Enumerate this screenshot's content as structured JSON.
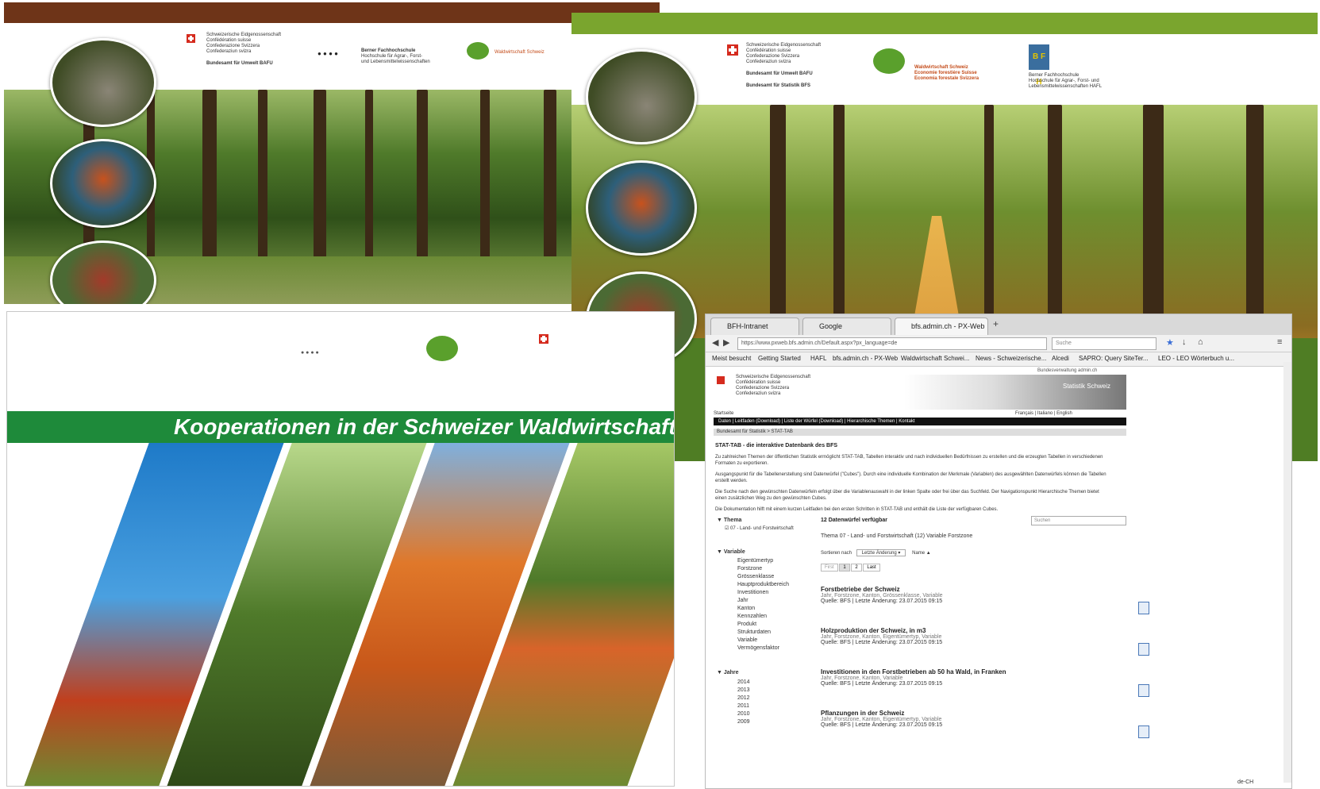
{
  "panel1": {
    "header_lines": [
      "Schweizerische Eidgenossenschaft",
      "Confédération suisse",
      "Confederazione Svizzera",
      "Confederaziun svizra"
    ],
    "office": "Bundesamt für Umwelt BAFU",
    "school": "Berner Fachhochschule",
    "school_sub": [
      "Hochschule für Agrar-, Forst-",
      "und Lebensmittelwissenschaften"
    ],
    "wvs": "Waldwirtschaft Schweiz"
  },
  "panel2": {
    "header_lines": [
      "Schweizerische Eidgenossenschaft",
      "Confédération suisse",
      "Confederazione Svizzera",
      "Confederaziun svizra"
    ],
    "office1": "Bundesamt für Umwelt BAFU",
    "office2": "Bundesamt für Statistik BFS",
    "wvs_lines": [
      "Waldwirtschaft Schweiz",
      "Economie forestière Suisse",
      "Economia forestale Svizzera"
    ],
    "school_lines": [
      "Berner Fachhochschule",
      "Hochschule für Agrar-, Forst- und",
      "Lebensmittelwissenschaften HAFL"
    ],
    "bfh_logo": "B F H"
  },
  "panel3": {
    "title": "Kooperationen in der Schweizer Waldwirtschaft"
  },
  "browser": {
    "tabs": [
      "BFH-Intranet",
      "Google",
      "bfs.admin.ch - PX-Web"
    ],
    "url": "https://www.pxweb.bfs.admin.ch/Default.aspx?px_language=de",
    "search_placeholder": "Suche",
    "bookmarks": [
      "Meist besucht",
      "Getting Started",
      "HAFL",
      "bfs.admin.ch - PX-Web",
      "Waldwirtschaft Schwei...",
      "News - Schweizerische...",
      "Alcedi",
      "SAPRO: Query SiteTer...",
      "LEO - LEO Wörterbuch u..."
    ],
    "site_header": [
      "Schweizerische Eidgenossenschaft",
      "Confédération suisse",
      "Confederazione Svizzera",
      "Confederaziun svizra"
    ],
    "site_brand": "Statistik Schweiz",
    "site_top": "Bundesverwaltung admin.ch",
    "breadcrumb_top": "Startseite",
    "languages": "Français | Italiano | English",
    "menu": "Daten | Leitfaden (Download) | Liste der Würfel (Download) | Hierarchische Themen | Kontakt",
    "breadcrumb": "Bundesamt für Statistik > STAT-TAB",
    "heading": "STAT-TAB - die interaktive Datenbank des BFS",
    "paragraphs": [
      "Zu zahlreichen Themen der öffentlichen Statistik ermöglicht STAT-TAB, Tabellen interaktiv und nach individuellen Bedürfnissen zu erstellen und die erzeugten Tabellen in verschiedenen Formaten zu exportieren.",
      "Ausgangspunkt für die Tabellenerstellung sind Datenwürfel (\"Cubes\"). Durch eine individuelle Kombination der Merkmale (Variablen) des ausgewählten Datenwürfels können die Tabellen erstellt werden.",
      "Die Suche nach den gewünschten Datenwürfeln erfolgt über die Variablenauswahl in der linken Spalte oder frei über das Suchfeld. Der Navigationspunkt Hierarchische Themen bietet einen zusätzlichen Weg zu den gewünschten Cubes.",
      "Die Dokumentation hilft mit einem kurzen Leitfaden bei den ersten Schritten in STAT-TAB und enthält die Liste der verfügbaren Cubes."
    ],
    "facets": {
      "thema_label": "Thema",
      "thema_item": "07 - Land- und Forstwirtschaft",
      "variable_label": "Variable",
      "variable_items": [
        "Eigentümertyp",
        "Forstzone",
        "Grössenklasse",
        "Hauptproduktbereich",
        "Investitionen",
        "Jahr",
        "Kanton",
        "Kennzahlen",
        "Produkt",
        "Strukturdaten",
        "Variable",
        "Vermögensfaktor"
      ],
      "jahr_label": "Jahre",
      "jahr_items": [
        "2014",
        "2013",
        "2012",
        "2011",
        "2010",
        "2009"
      ]
    },
    "results_count": "12 Datenwürfel verfügbar",
    "search_box": "Suchen",
    "filter_line": "Thema  07 - Land- und Forstwirtschaft (12)   Variable  Forstzone",
    "sort_label": "Sortieren nach",
    "sort_value": "Letzte Änderung",
    "sort_dir": "Name",
    "pager": [
      "First",
      "1",
      "2",
      "Last"
    ],
    "results": [
      {
        "title": "Forstbetriebe der Schweiz",
        "meta": "Jahr, Forstzone, Kanton, Grössenklasse, Variable",
        "src": "Quelle: BFS | Letzte Änderung: 23.07.2015 09:15"
      },
      {
        "title": "Holzproduktion der Schweiz, in m3",
        "meta": "Jahr, Forstzone, Kanton, Eigentümertyp, Variable",
        "src": "Quelle: BFS | Letzte Änderung: 23.07.2015 09:15"
      },
      {
        "title": "Investitionen in den Forstbetrieben ab 50 ha Wald, in Franken",
        "meta": "Jahr, Forstzone, Kanton, Variable",
        "src": "Quelle: BFS | Letzte Änderung: 23.07.2015 09:15"
      },
      {
        "title": "Pflanzungen in der Schweiz",
        "meta": "Jahr, Forstzone, Kanton, Eigentümertyp, Variable",
        "src": "Quelle: BFS | Letzte Änderung: 23.07.2015 09:15"
      }
    ],
    "status_locale": "de-CH"
  }
}
